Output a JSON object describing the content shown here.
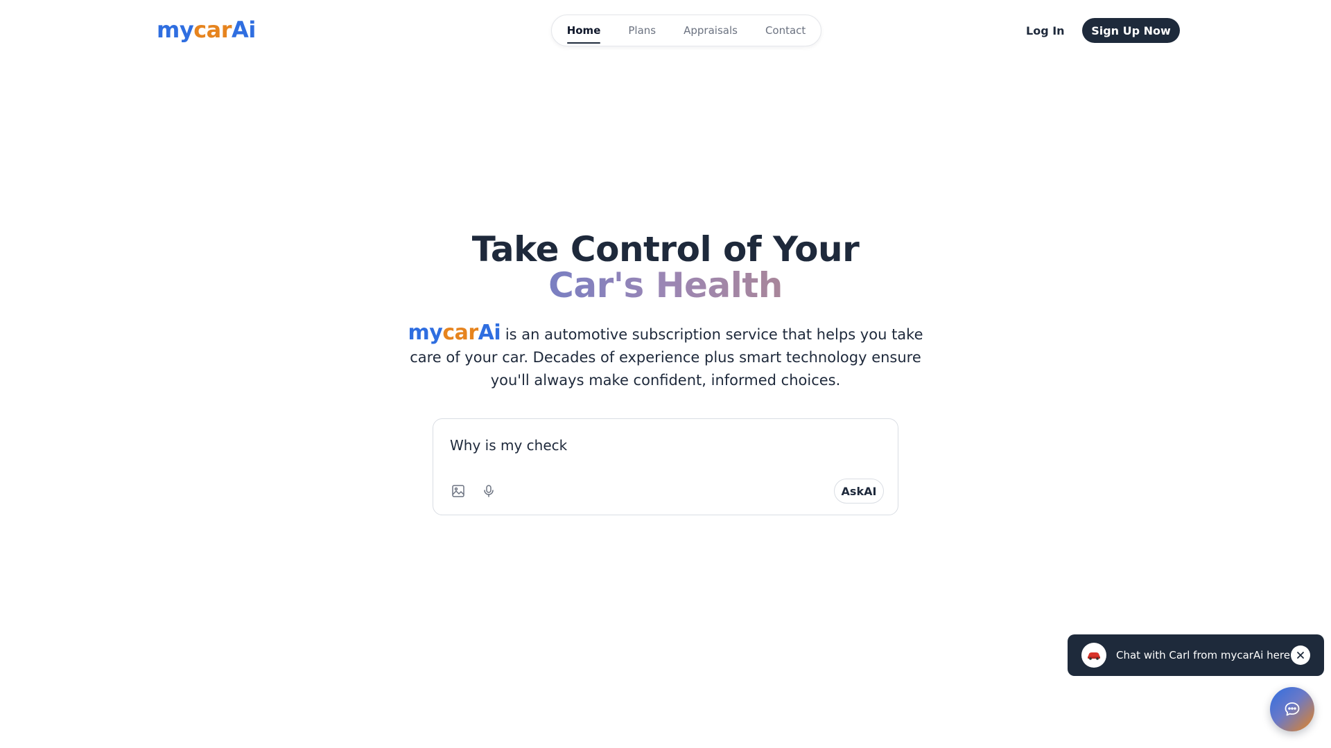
{
  "brand": {
    "part1": "my",
    "part2": "car",
    "part3": "Ai"
  },
  "nav": {
    "tabs": [
      {
        "label": "Home",
        "active": true
      },
      {
        "label": "Plans",
        "active": false
      },
      {
        "label": "Appraisals",
        "active": false
      },
      {
        "label": "Contact",
        "active": false
      }
    ]
  },
  "header": {
    "login_label": "Log In",
    "signup_label": "Sign Up Now"
  },
  "hero": {
    "title_line1": "Take Control of Your",
    "title_line2": "Car's Health",
    "subtitle_text": " is an automotive subscription service that helps you take care of your car. Decades of experience plus smart technology ensure you'll always make confident, informed choices."
  },
  "ask": {
    "input_value": "Why is my check",
    "image_icon": "image-icon",
    "mic_icon": "microphone-icon",
    "button_label": "AskAI"
  },
  "chat": {
    "message": "Chat with Carl from mycarAi here",
    "avatar_icon": "car-logo-icon",
    "close_icon": "close-icon",
    "fab_icon": "chat-bubble-icon"
  },
  "colors": {
    "brand_blue": "#2f6ee0",
    "brand_orange": "#e6841f",
    "dark_navy": "#1e2a3b"
  }
}
